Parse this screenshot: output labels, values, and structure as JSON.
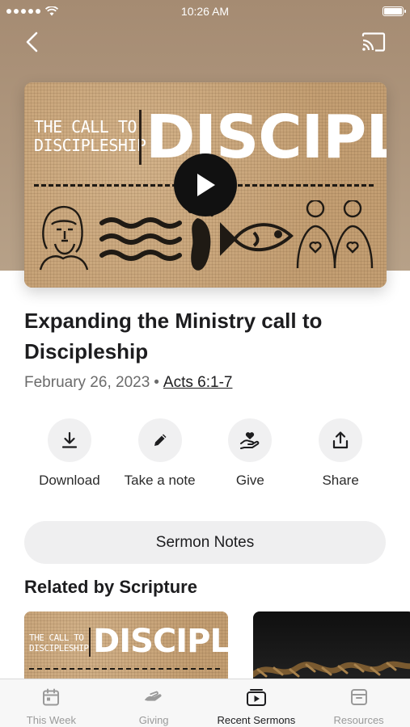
{
  "status_bar": {
    "time": "10:26 AM"
  },
  "sermon": {
    "artwork": {
      "small_title_line1": "THE CALL TO",
      "small_title_line2": "DISCIPLESHIP",
      "big_title": "DISCIPLE"
    },
    "title": "Expanding the Ministry call to Discipleship",
    "date": "February 26, 2023",
    "separator": "•",
    "scripture": "Acts 6:1-7"
  },
  "actions": [
    {
      "label": "Download",
      "icon": "download-icon"
    },
    {
      "label": "Take a note",
      "icon": "pencil-icon"
    },
    {
      "label": "Give",
      "icon": "give-hand-heart-icon"
    },
    {
      "label": "Share",
      "icon": "share-icon"
    }
  ],
  "notes_button": "Sermon Notes",
  "related": {
    "title": "Related by Scripture",
    "cards": [
      {
        "small_line1": "THE CALL TO",
        "small_line2": "DISCIPLESHIP",
        "big": "DISCIPLE"
      },
      {
        "image": "rope-dark-image"
      }
    ]
  },
  "tabbar": {
    "tabs": [
      {
        "label": "This Week",
        "icon": "calendar-icon",
        "active": false
      },
      {
        "label": "Giving",
        "icon": "giving-hand-icon",
        "active": false
      },
      {
        "label": "Recent Sermons",
        "icon": "sermons-play-icon",
        "active": true
      },
      {
        "label": "Resources",
        "icon": "archive-box-icon",
        "active": false
      }
    ]
  },
  "colors": {
    "hero_background": "#a58b72",
    "burlap": "#c9a87f",
    "button_gray": "#efeff0",
    "tab_inactive": "#9a9a9a"
  }
}
